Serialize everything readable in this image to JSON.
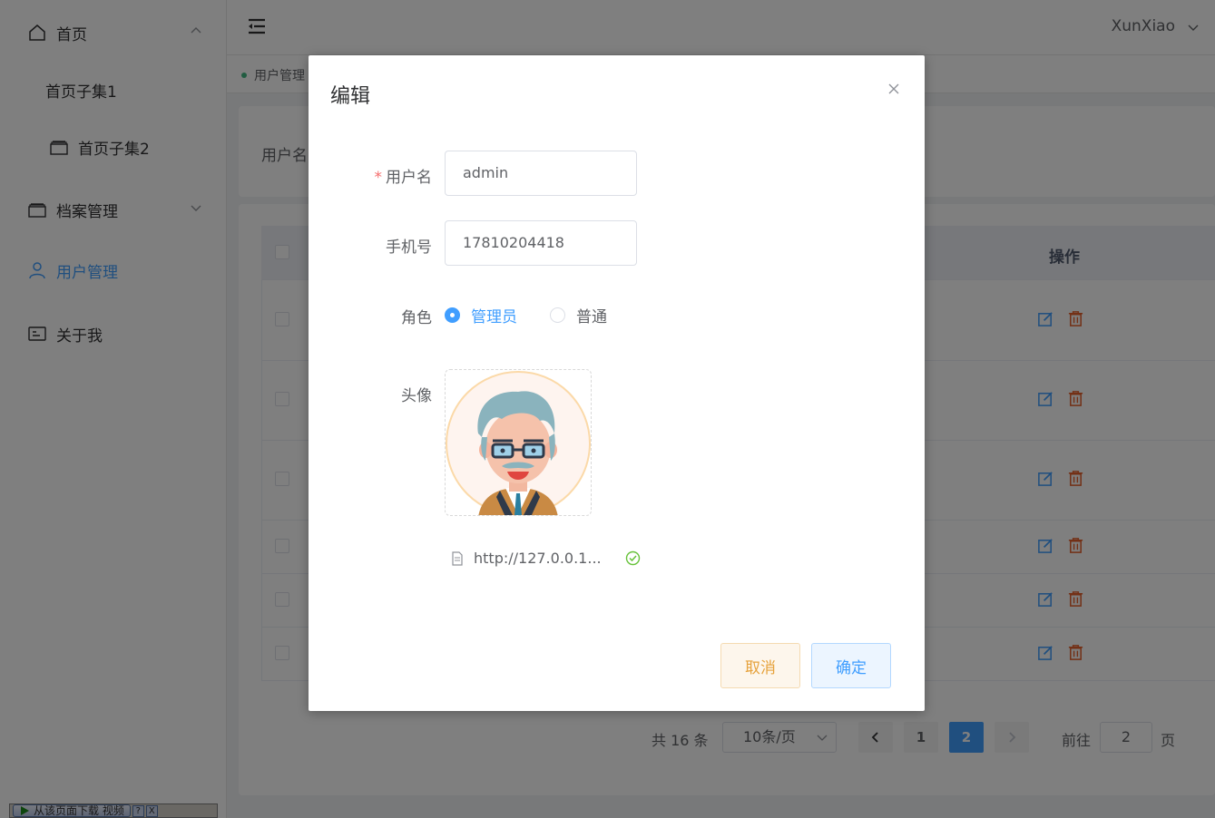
{
  "sidebar": {
    "items": [
      {
        "label": "首页",
        "icon": "home-icon"
      },
      {
        "label": "首页子集1"
      },
      {
        "label": "首页子集2",
        "icon": "folder-icon"
      },
      {
        "label": "档案管理",
        "icon": "folder-icon"
      },
      {
        "label": "用户管理",
        "icon": "user-icon",
        "active": true
      },
      {
        "label": "关于我",
        "icon": "id-card-icon"
      }
    ]
  },
  "header": {
    "user": "XunXiao",
    "fold_icon": "menu-fold-icon"
  },
  "tags": {
    "current": "用户管理"
  },
  "search": {
    "label": "用户名"
  },
  "table": {
    "op_header": "操作",
    "row_count": 6
  },
  "pagination": {
    "total": "共 16 条",
    "page_size": "10条/页",
    "pages": [
      "1",
      "2"
    ],
    "current_page": "2",
    "goto_label": "前往",
    "goto_value": "2",
    "page_unit": "页"
  },
  "download_bar": {
    "label": "从该页面下载 视频",
    "help": "?",
    "close": "X"
  },
  "dialog": {
    "title": "编辑",
    "username_label": "用户名",
    "username_value": "admin",
    "phone_label": "手机号",
    "phone_value": "17810204418",
    "role_label": "角色",
    "role_options": [
      "管理员",
      "普通"
    ],
    "role_selected": "管理员",
    "avatar_label": "头像",
    "file_name": "http://127.0.0.1...",
    "cancel_label": "取消",
    "confirm_label": "确定"
  },
  "colors": {
    "primary": "#409eff",
    "danger": "#f56c6c",
    "warning": "#e6a23c",
    "success": "#67c23a"
  }
}
